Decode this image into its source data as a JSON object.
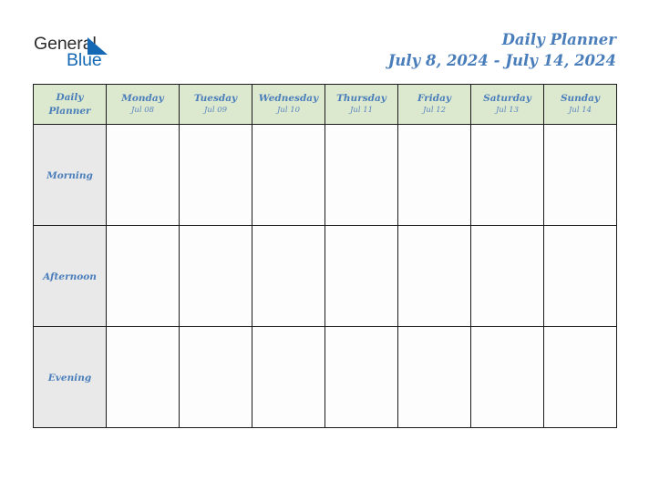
{
  "branding": {
    "logo_word_one": "General",
    "logo_word_two": "Blue",
    "logo_icon": "triangle-icon",
    "word_one_color": "#2b2b2b",
    "word_two_color": "#1569b4",
    "triangle_color": "#1569b4"
  },
  "header": {
    "title": "Daily Planner",
    "date_range": "July 8, 2024 - July 14, 2024",
    "title_color": "#4a7ebb"
  },
  "theme": {
    "header_cell_background": "#dde9cf",
    "row_label_background": "#e9e9e9",
    "cell_background": "#fdfdfd",
    "grid_line_color": "#1a1a1a",
    "accent_text": "#4a7ebb",
    "page_background": "#ffffff"
  },
  "table": {
    "corner_label_line_one": "Daily",
    "corner_label_line_two": "Planner",
    "columns": [
      {
        "day": "Monday",
        "date": "Jul 08"
      },
      {
        "day": "Tuesday",
        "date": "Jul 09"
      },
      {
        "day": "Wednesday",
        "date": "Jul 10"
      },
      {
        "day": "Thursday",
        "date": "Jul 11"
      },
      {
        "day": "Friday",
        "date": "Jul 12"
      },
      {
        "day": "Saturday",
        "date": "Jul 13"
      },
      {
        "day": "Sunday",
        "date": "Jul 14"
      }
    ],
    "rows": [
      {
        "label": "Morning",
        "entries": [
          "",
          "",
          "",
          "",
          "",
          "",
          ""
        ]
      },
      {
        "label": "Afternoon",
        "entries": [
          "",
          "",
          "",
          "",
          "",
          "",
          ""
        ]
      },
      {
        "label": "Evening",
        "entries": [
          "",
          "",
          "",
          "",
          "",
          "",
          ""
        ]
      }
    ]
  }
}
